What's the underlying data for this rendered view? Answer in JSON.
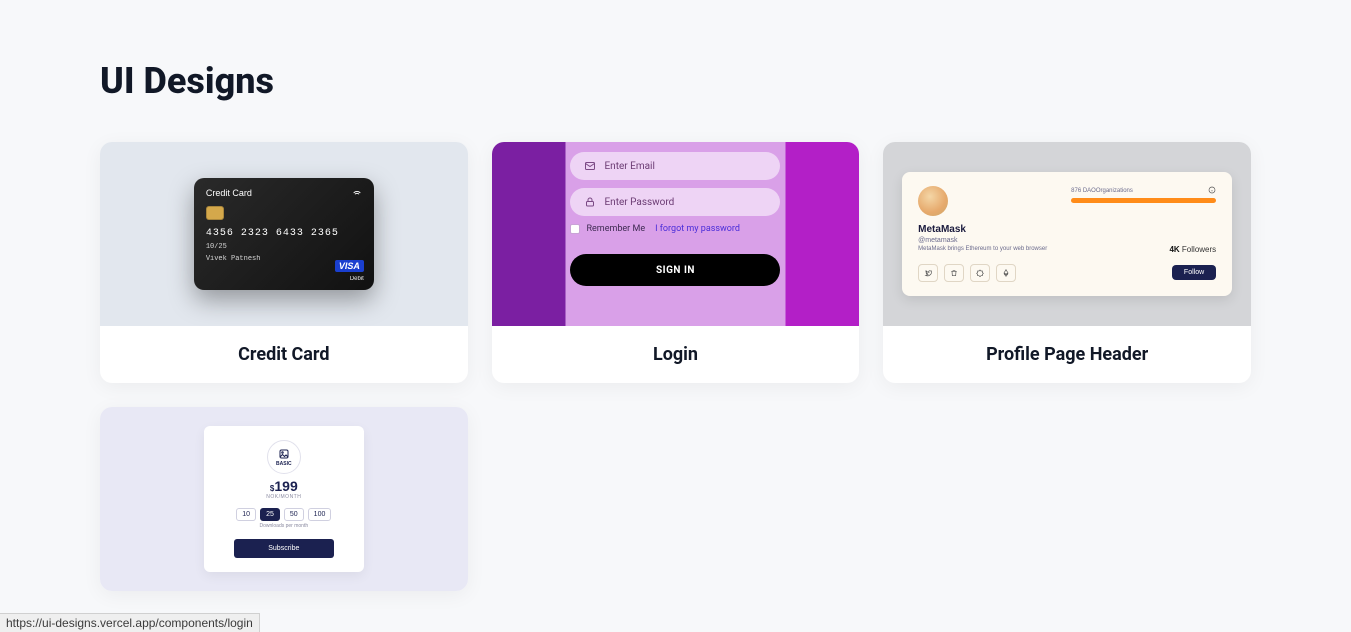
{
  "page": {
    "title": "UI Designs"
  },
  "cards": {
    "credit_card": {
      "title": "Credit Card",
      "label": "Credit Card",
      "number": "4356 2323 6433 2365",
      "expiry": "10/25",
      "holder": "Vivek Patnesh",
      "brand": "VISA",
      "type": "Debit"
    },
    "login": {
      "title": "Login",
      "email_placeholder": "Enter Email",
      "password_placeholder": "Enter Password",
      "remember": "Remember Me",
      "forgot": "I forgot my password",
      "signin": "SIGN IN"
    },
    "profile": {
      "title": "Profile Page Header",
      "name": "MetaMask",
      "handle": "@metamask",
      "description": "MetaMask brings Ethereum to your web browser",
      "stat_label": "DAOOrganizations",
      "stat_value": "876",
      "followers_count": "4K",
      "followers_label": "Followers",
      "follow_btn": "Follow"
    },
    "pricing": {
      "plan": "BASIC",
      "currency": "$",
      "price": "199",
      "period": "NOK/MONTH",
      "options": [
        "10",
        "25",
        "50",
        "100"
      ],
      "selected_index": 1,
      "downloads_label": "Downloads per month",
      "subscribe": "Subscribe"
    }
  },
  "status_url": "https://ui-designs.vercel.app/components/login"
}
